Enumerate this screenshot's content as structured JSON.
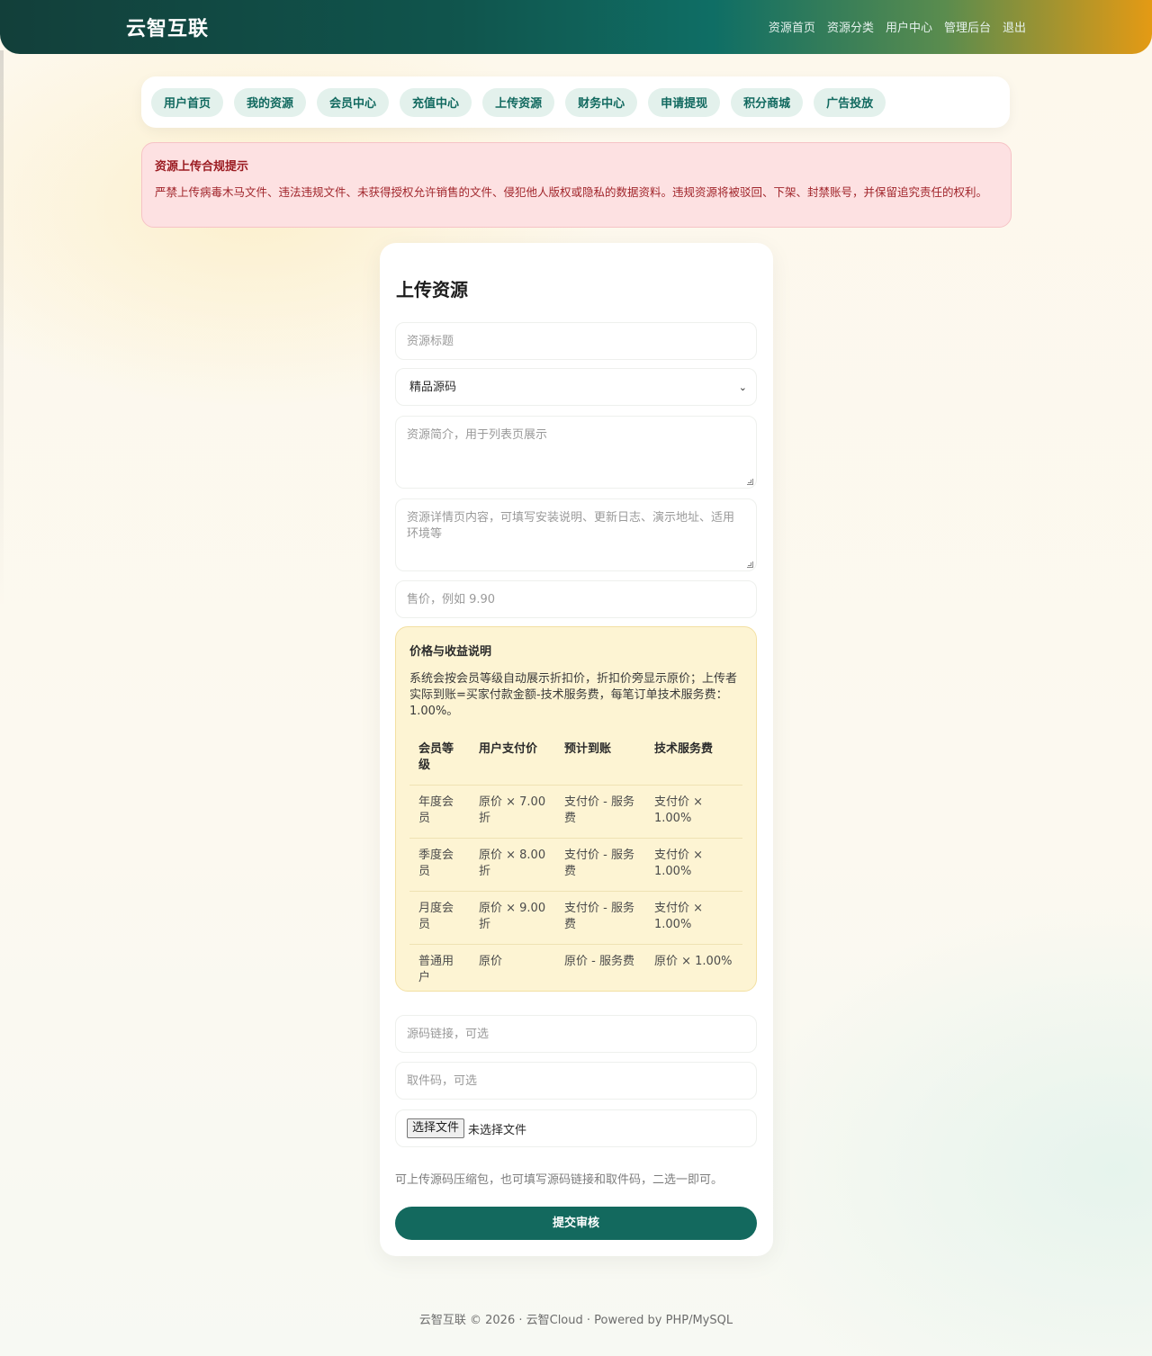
{
  "header": {
    "brand": "云智互联",
    "nav": [
      "资源首页",
      "资源分类",
      "用户中心",
      "管理后台",
      "退出"
    ]
  },
  "tabs": [
    "用户首页",
    "我的资源",
    "会员中心",
    "充值中心",
    "上传资源",
    "财务中心",
    "申请提现",
    "积分商城",
    "广告投放"
  ],
  "notice": {
    "title": "资源上传合规提示",
    "text": "严禁上传病毒木马文件、违法违规文件、未获得授权允许销售的文件、侵犯他人版权或隐私的数据资料。违规资源将被驳回、下架、封禁账号，并保留追究责任的权利。"
  },
  "form": {
    "title": "上传资源",
    "title_placeholder": "资源标题",
    "category_selected": "精品源码",
    "summary_placeholder": "资源简介，用于列表页展示",
    "detail_placeholder": "资源详情页内容，可填写安装说明、更新日志、演示地址、适用环境等",
    "price_placeholder": "售价，例如 9.90",
    "link_placeholder": "源码链接，可选",
    "code_placeholder": "取件码，可选",
    "file_button": "选择文件",
    "file_status": "未选择文件",
    "hint": "可上传源码压缩包，也可填写源码链接和取件码，二选一即可。",
    "submit": "提交审核"
  },
  "pricing": {
    "title": "价格与收益说明",
    "text": "系统会按会员等级自动展示折扣价，折扣价旁显示原价；上传者实际到账=买家付款金额-技术服务费，每笔订单技术服务费：1.00%。",
    "headers": [
      "会员等级",
      "用户支付价",
      "预计到账",
      "技术服务费"
    ],
    "rows": [
      [
        "年度会员",
        "原价 × 7.00 折",
        "支付价 - 服务费",
        "支付价 × 1.00%"
      ],
      [
        "季度会员",
        "原价 × 8.00 折",
        "支付价 - 服务费",
        "支付价 × 1.00%"
      ],
      [
        "月度会员",
        "原价 × 9.00 折",
        "支付价 - 服务费",
        "支付价 × 1.00%"
      ],
      [
        "普通用户",
        "原价",
        "原价 - 服务费",
        "原价 × 1.00%"
      ]
    ]
  },
  "footer": "云智互联 © 2026 · 云智Cloud · Powered by PHP/MySQL"
}
